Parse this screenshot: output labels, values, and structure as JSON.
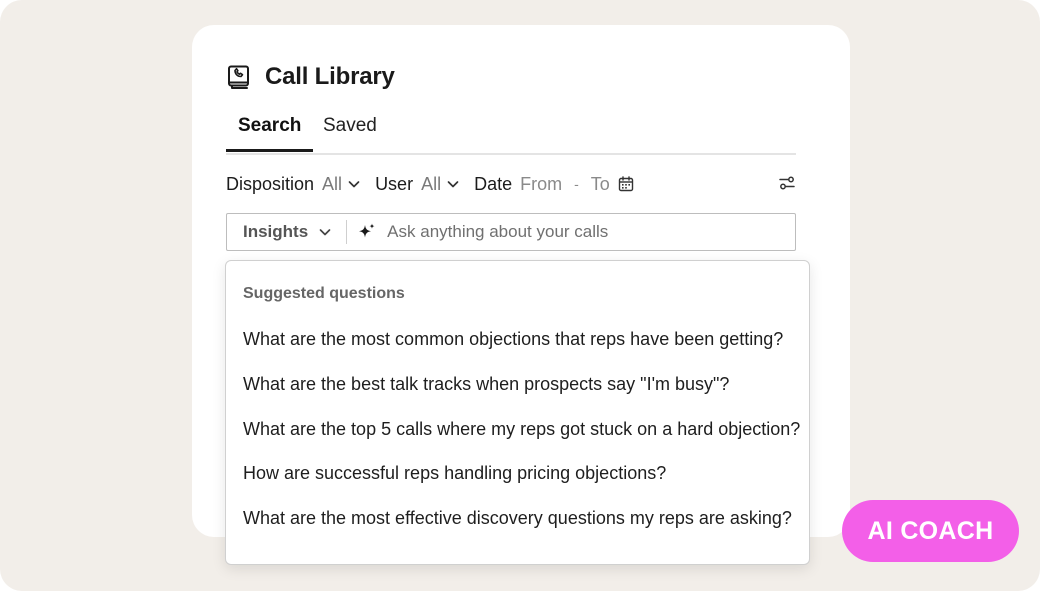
{
  "header": {
    "title": "Call Library",
    "icon": "phone-book-icon"
  },
  "tabs": [
    {
      "label": "Search",
      "active": true
    },
    {
      "label": "Saved",
      "active": false
    }
  ],
  "filters": {
    "disposition": {
      "label": "Disposition",
      "value": "All"
    },
    "user": {
      "label": "User",
      "value": "All"
    },
    "date": {
      "label": "Date",
      "from": "From",
      "separator": "-",
      "to": "To"
    }
  },
  "search": {
    "mode": "Insights",
    "placeholder": "Ask anything about your calls"
  },
  "suggestions": {
    "heading": "Suggested questions",
    "items": [
      "What are the most common objections that reps have been getting?",
      "What are the best talk tracks when prospects say \"I'm busy\"?",
      "What are the top 5 calls where my reps got stuck on a hard objection?",
      "How are successful reps handling pricing objections?",
      "What are the most effective discovery questions my reps are asking?"
    ]
  },
  "badge": {
    "label": "AI COACH",
    "color": "#f35fe8"
  },
  "colors": {
    "background": "#f2eee9",
    "card": "#ffffff",
    "text": "#1a1a1a",
    "muted": "#7a7a7a"
  }
}
